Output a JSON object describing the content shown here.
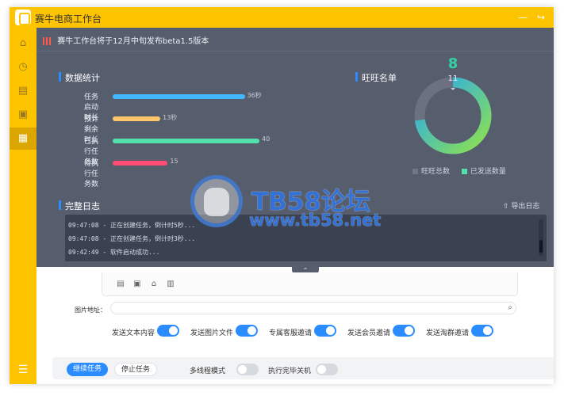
{
  "window": {
    "title": "赛牛电商工作台",
    "minimize_icon": "minimize-icon",
    "exit_icon": "exit-icon"
  },
  "notice": "赛牛工作台将于12月中旬发布beta1.5版本",
  "stats": {
    "title": "数据统计",
    "rows": [
      {
        "label": "任务启动时长",
        "value": 36,
        "value_text": "36秒",
        "color": "#41b8ff"
      },
      {
        "label": "预计剩余时长",
        "value": 13,
        "value_text": "13秒",
        "color": "#ffc66b"
      },
      {
        "label": "已执行任务数",
        "value": 40,
        "value_text": "40",
        "color": "#54e0ad"
      },
      {
        "label": "待执行任务数",
        "value": 15,
        "value_text": "15",
        "color": "#ff4c74"
      }
    ]
  },
  "ranking": {
    "title": "旺旺名单",
    "sent": "8",
    "total": "11",
    "legend": [
      "旺旺总数",
      "已发送数量"
    ]
  },
  "logs": {
    "title": "完整日志",
    "export_label": "导出日志",
    "lines": [
      "09:47:08 - 正在创建任务，倒计时5秒...",
      "09:47:08 - 正在创建任务，倒计时3秒...",
      "09:42:49 - 软件启动成功..."
    ]
  },
  "image_field": {
    "label": "图片地址：",
    "value": ""
  },
  "switches": [
    {
      "label": "发送文本内容",
      "on": true
    },
    {
      "label": "发送图片文件",
      "on": true
    },
    {
      "label": "专属客服邀请",
      "on": true
    },
    {
      "label": "发送会员邀请",
      "on": true
    },
    {
      "label": "发送淘群邀请",
      "on": true
    }
  ],
  "footer": {
    "continue_label": "继续任务",
    "stop_label": "停止任务",
    "multithread_label": "多线程模式",
    "shutdown_label": "执行完毕关机",
    "multithread_on": false,
    "shutdown_on": false
  },
  "watermark": {
    "title": "TB58论坛",
    "url": "www.tb58.net"
  },
  "colors": {
    "accent": "#ffc400",
    "primary": "#2a8cff",
    "overlay": "#565d6d",
    "donut_start": "#8ee24d",
    "donut_end": "#24a8f5"
  }
}
